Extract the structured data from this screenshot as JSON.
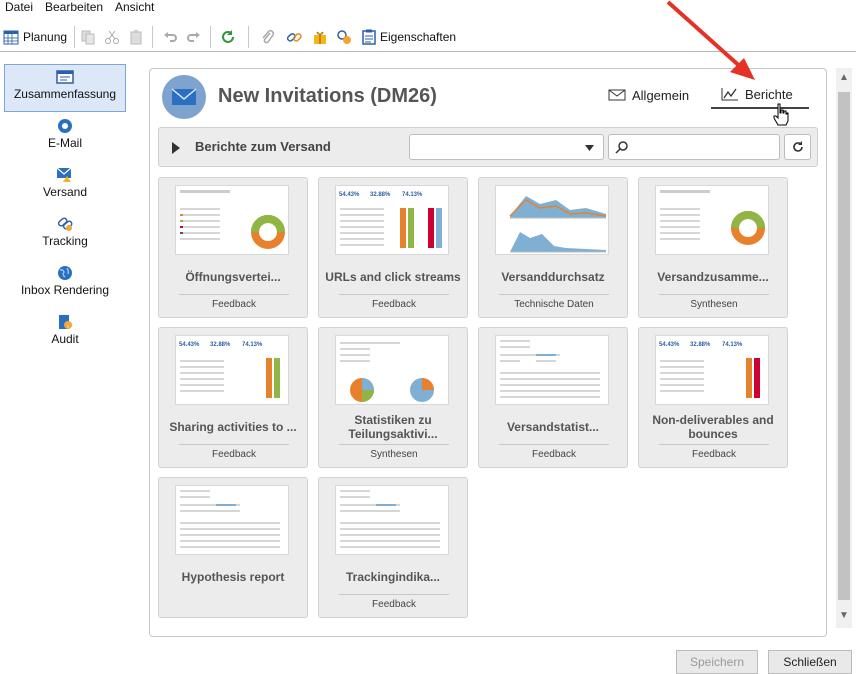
{
  "menu": {
    "items": [
      "Datei",
      "Bearbeiten",
      "Ansicht"
    ]
  },
  "toolbar": {
    "planung_label": "Planung",
    "eigenschaften_label": "Eigenschaften"
  },
  "nav": {
    "items": [
      {
        "label": "Zusammenfassung",
        "icon": "summary-icon",
        "active": true
      },
      {
        "label": "E-Mail",
        "icon": "email-icon"
      },
      {
        "label": "Versand",
        "icon": "delivery-icon"
      },
      {
        "label": "Tracking",
        "icon": "tracking-icon"
      },
      {
        "label": "Inbox Rendering",
        "icon": "globe-icon"
      },
      {
        "label": "Audit",
        "icon": "audit-icon"
      }
    ]
  },
  "header": {
    "title": "New Invitations (DM26)",
    "tabs": [
      {
        "label": "Allgemein",
        "icon": "envelope-icon"
      },
      {
        "label": "Berichte",
        "icon": "chart-line-icon",
        "active": true
      }
    ]
  },
  "section": {
    "title": "Berichte zum Versand",
    "select_value": "",
    "search_placeholder": ""
  },
  "cards": [
    {
      "title": "Öffnungsverteі...",
      "category": "Feedback"
    },
    {
      "title": "URLs and click streams",
      "category": "Feedback"
    },
    {
      "title": "Versanddurchsatz",
      "category": "Technische Daten"
    },
    {
      "title": "Versandzusamme...",
      "category": "Synthesen"
    },
    {
      "title": "Sharing activities to ...",
      "category": "Feedback"
    },
    {
      "title": "Statistiken zu Teilungsaktivi...",
      "category": "Synthesen"
    },
    {
      "title": "Versandstatist...",
      "category": "Feedback"
    },
    {
      "title": "Non-deliverables and bounces",
      "category": "Feedback"
    },
    {
      "title": "Hypothesis report",
      "category": ""
    },
    {
      "title": "Trackingindika...",
      "category": "Feedback"
    }
  ],
  "thumb_text": {
    "kpi1": "54.43%",
    "kpi2": "32.88%",
    "kpi3": "74.13%"
  },
  "footer": {
    "save_label": "Speichern",
    "close_label": "Schließen"
  },
  "colors": {
    "accent": "#7aa6dd",
    "arrow": "#e53225",
    "donut_orange": "#e8812b",
    "donut_green": "#8fb545",
    "chart_blue": "#7fb0d4"
  }
}
